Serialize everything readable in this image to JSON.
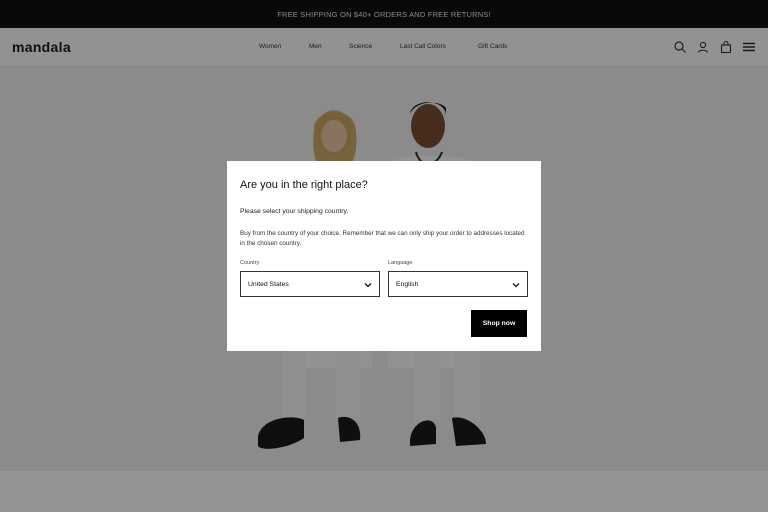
{
  "announcement": "FREE SHIPPING ON $40+ ORDERS AND FREE RETURNS!",
  "brand": "mandala",
  "nav": [
    "Women",
    "Men",
    "Science",
    "Last Call Colors",
    "Gift Cards"
  ],
  "header_icons": [
    "search-icon",
    "account-icon",
    "cart-icon",
    "menu-icon"
  ],
  "modal": {
    "title": "Are you in the right place?",
    "subtitle": "Please select your shipping country.",
    "description": "Buy from the country of your choice. Remember that we can only ship your order to addresses located in the chosen country.",
    "country": {
      "label": "Country",
      "value": "United States"
    },
    "language": {
      "label": "Language",
      "value": "English"
    },
    "button": "Shop now"
  },
  "colors": {
    "bar": "#111111",
    "button": "#000000",
    "overlay": "rgba(0,0,0,0.42)"
  }
}
